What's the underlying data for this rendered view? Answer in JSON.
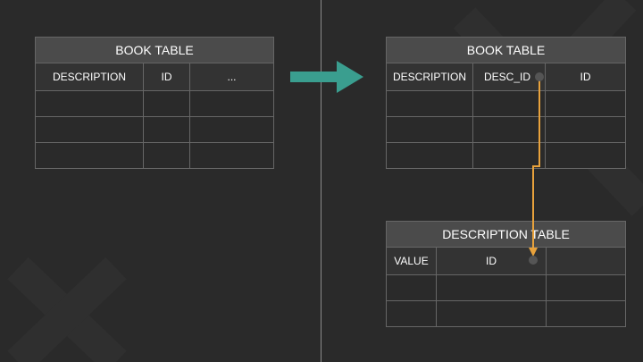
{
  "left_table": {
    "title": "BOOK TABLE",
    "columns": [
      "DESCRIPTION",
      "ID",
      "..."
    ],
    "empty_rows": 3
  },
  "right_book_table": {
    "title": "BOOK TABLE",
    "columns": [
      "DESCRIPTION",
      "DESC_ID",
      "ID"
    ],
    "empty_rows": 3
  },
  "description_table": {
    "title": "DESCRIPTION TABLE",
    "columns": [
      "VALUE",
      "ID",
      ""
    ],
    "empty_rows": 2
  },
  "colors": {
    "background": "#2a2a2a",
    "arrow": "#3a9e8f",
    "connector": "#e8a23c",
    "header": "#4b4b4b"
  },
  "icons": {
    "transform_arrow": "right-arrow-icon",
    "link_dot": "connector-dot-icon"
  }
}
